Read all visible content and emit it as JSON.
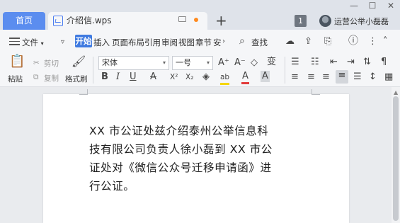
{
  "tabs": {
    "home": "首页",
    "document": "介绍信.wps",
    "new_tab": "+"
  },
  "header": {
    "badge": "1",
    "user_name": "运营公举小磊磊",
    "window_controls": [
      "—",
      "☐",
      "✕"
    ]
  },
  "menu": {
    "file": "文件",
    "tabs": [
      "开始",
      "插入",
      "页面布局",
      "引用",
      "审阅",
      "视图",
      "章节",
      "安"
    ],
    "active_tab": "开始",
    "find": "查找"
  },
  "ribbon": {
    "paste": "粘贴",
    "cut": "剪切",
    "copy": "复制",
    "format_painter": "格式刷",
    "font_name": "宋体",
    "font_size": "一号",
    "bold": "B",
    "italic": "I",
    "underline": "U",
    "strike": "A",
    "superscript": "X²",
    "subscript": "X₂",
    "highlight": "ab",
    "font_color": "A",
    "char_shading": "A",
    "grow_font": "A⁺",
    "shrink_font": "A⁻",
    "phonetic": "变"
  },
  "document": {
    "lines": [
      "XX 市公证处兹介绍泰州公举信息科",
      "技有限公司负责人徐小磊到 XX 市公",
      "证处对《微信公众号迁移申请函》进",
      "行公证。"
    ]
  },
  "colors": {
    "accent": "#3f7ae0",
    "home_tab": "#5b8def",
    "unsaved_dot": "#ff8a1f"
  }
}
